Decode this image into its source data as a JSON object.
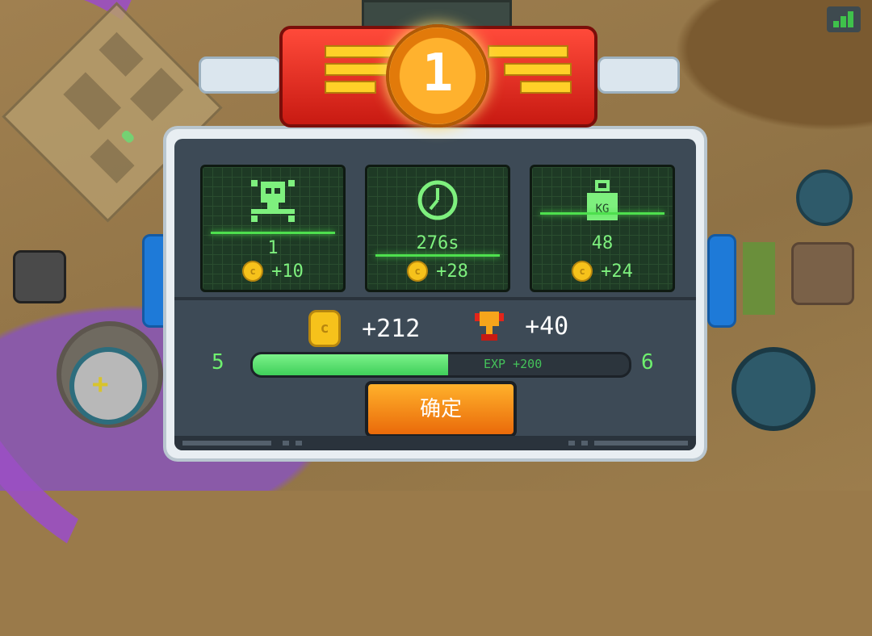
{
  "hud": {
    "signal_icon": "signal-bars-icon",
    "left_joystick_symbol": "+"
  },
  "result": {
    "rank": "1",
    "stats": [
      {
        "icon": "skull-crossbones-icon",
        "value": "1",
        "reward": "+10"
      },
      {
        "icon": "clock-icon",
        "value": "276s",
        "reward": "+28"
      },
      {
        "icon": "weight-kg-icon",
        "value": "48",
        "reward": "+24"
      }
    ],
    "total_coins": "+212",
    "total_trophies": "+40",
    "level_from": "5",
    "level_to": "6",
    "exp_label": "EXP +200",
    "exp_progress": 0.52,
    "confirm_label": "确定"
  },
  "colors": {
    "panel": "#3d4a56",
    "accent_green": "#7ef07e",
    "ribbon_red": "#e3251a",
    "medal_orange": "#ffb22e",
    "button_orange": "#f58a15"
  }
}
